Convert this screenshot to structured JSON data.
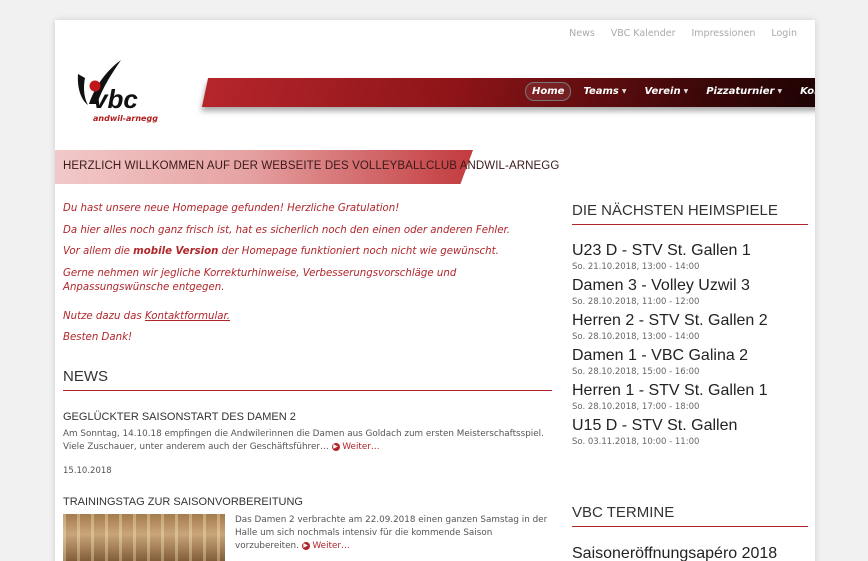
{
  "topnav": [
    "News",
    "VBC Kalender",
    "Impressionen",
    "Login"
  ],
  "logo": {
    "text": "vbc",
    "subtitle": "andwil-arnegg"
  },
  "mainnav": [
    {
      "label": "Home",
      "active": true
    },
    {
      "label": "Teams"
    },
    {
      "label": "Verein"
    },
    {
      "label": "Pizzaturnier"
    },
    {
      "label": "Kontakt"
    }
  ],
  "welcome": "HERZLICH WILLKOMMEN AUF DER WEBSEITE DES VOLLEYBALLCLUB ANDWIL-ARNEGG",
  "intro": {
    "p1": "Du hast unsere neue Homepage gefunden! Herzliche Gratulation!",
    "p2": "Da hier alles noch ganz frisch ist, hat es sicherlich noch den einen oder anderen Fehler.",
    "p3_before": "Vor allem die ",
    "p3_bold": "mobile Version",
    "p3_after": " der Homepage funktioniert noch nicht wie gewünscht.",
    "p4": "Gerne nehmen wir jegliche Korrekturhinweise, Verbesserungsvorschläge und Anpassungswünsche entgegen.",
    "p5_before": "Nutze dazu das ",
    "p5_link": "Kontaktformular.",
    "p6": "Besten Dank!"
  },
  "news": {
    "title": "NEWS",
    "items": [
      {
        "title": "GEGLÜCKTER SAISONSTART DES DAMEN 2",
        "text": "Am Sonntag, 14.10.18 empfingen die Andwilerinnen die Damen aus Goldach zum ersten Meisterschaftsspiel. Viele Zuschauer, unter anderem auch der Geschäftsführer…",
        "more": "Weiter…",
        "date": "15.10.2018"
      },
      {
        "title": "TRAININGSTAG ZUR SAISONVORBEREITUNG",
        "text": "Das Damen 2 verbrachte am 22.09.2018 einen ganzen Samstag in der Halle um sich nochmals intensiv für die kommende Saison vorzubereiten.",
        "more": "Weiter…"
      }
    ]
  },
  "heimspiele": {
    "title": "DIE NÄCHSTEN HEIMSPIELE",
    "games": [
      {
        "title": "U23 D - STV St. Gallen 1",
        "date": "So. 21.10.2018, 13:00 - 14:00"
      },
      {
        "title": "Damen 3 - Volley Uzwil 3",
        "date": "So. 28.10.2018, 11:00 - 12:00"
      },
      {
        "title": "Herren 2 - STV St. Gallen 2",
        "date": "So. 28.10.2018, 13:00 - 14:00"
      },
      {
        "title": "Damen 1 - VBC Galina 2",
        "date": "So. 28.10.2018, 15:00 - 16:00"
      },
      {
        "title": "Herren 1 - STV St. Gallen 1",
        "date": "So. 28.10.2018, 17:00 - 18:00"
      },
      {
        "title": "U15 D - STV St. Gallen",
        "date": "So. 03.11.2018, 10:00 - 11:00"
      }
    ]
  },
  "termine": {
    "title": "VBC TERMINE",
    "items": [
      "Saisoneröffnungsapéro 2018"
    ]
  },
  "colors": {
    "accent": "#b0262b",
    "nav_dark": "#1a0203"
  },
  "icons": {
    "more": "circle-arrow-right-icon",
    "caret": "caret-down-icon"
  }
}
